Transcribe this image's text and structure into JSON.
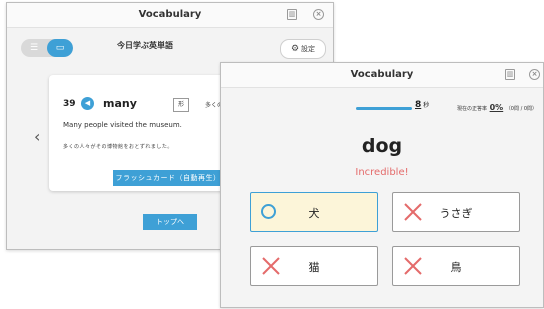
{
  "window1": {
    "title": "Vocabulary",
    "heading": "今日学ぶ英単語",
    "settings_label": "設定",
    "card": {
      "number": "39",
      "word": "many",
      "pos": "形",
      "meaning": "多くの",
      "example_en": "Many people visited the museum.",
      "example_ja": "多くの人々がその博物館をおとずれました。",
      "flashcard_button": "フラッシュカード（自動再生）"
    },
    "top_button": "トップへ"
  },
  "window2": {
    "title": "Vocabulary",
    "timer_value": "8",
    "timer_unit": "秒",
    "accuracy_prefix": "現在の正答率",
    "accuracy_value": "0%",
    "accuracy_detail": "（0問 / 0問）",
    "question_word": "dog",
    "feedback": "Incredible!",
    "options": [
      {
        "label": "犬",
        "state": "correct"
      },
      {
        "label": "うさぎ",
        "state": "wrong"
      },
      {
        "label": "猫",
        "state": "wrong"
      },
      {
        "label": "鳥",
        "state": "wrong"
      }
    ]
  },
  "colors": {
    "accent": "#3ea0d6",
    "wrong": "#e46b6b",
    "correct_bg": "#fcf5d9"
  }
}
